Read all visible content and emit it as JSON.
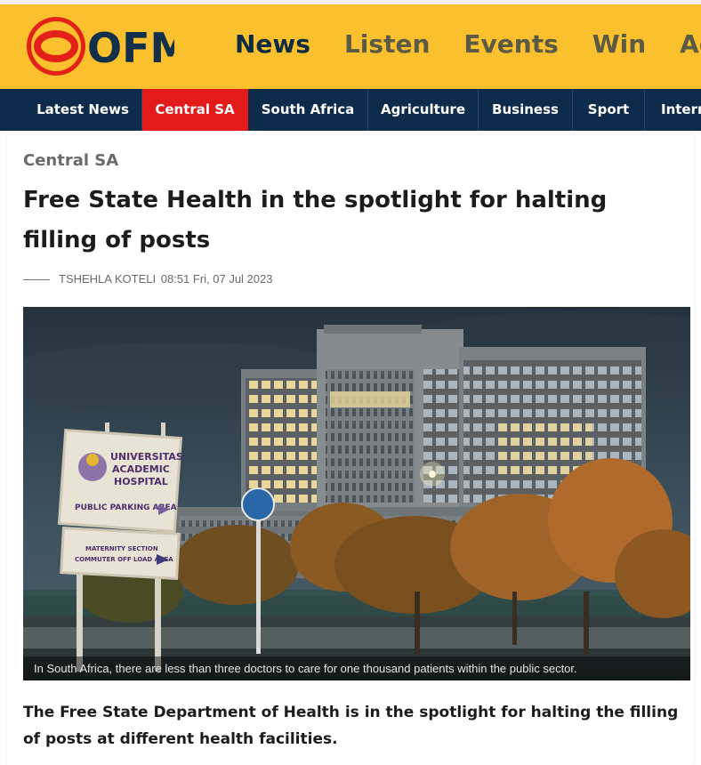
{
  "header": {
    "logo": {
      "text": "OFM",
      "icon": "ofm-logo-icon",
      "colors": {
        "ring": "#e32119",
        "text": "#12304a"
      }
    },
    "nav": [
      "News",
      "Listen",
      "Events",
      "Win",
      "Adv"
    ],
    "active_nav": "News"
  },
  "subnav": {
    "items": [
      "Latest News",
      "Central SA",
      "South Africa",
      "Agriculture",
      "Business",
      "Sport",
      "Intern"
    ],
    "active": "Central SA"
  },
  "article": {
    "category": "Central SA",
    "title": "Free State Health in the spotlight for halting filling of posts",
    "author": "TSHEHLA KOTELI",
    "datetime": "08:51 Fri, 07 Jul 2023",
    "image": {
      "signs": {
        "hospital_name": [
          "UNIVERSITAS",
          "ACADEMIC",
          "HOSPITAL"
        ],
        "parking": "PUBLIC PARKING AREA",
        "maternity": [
          "MATERNITY SECTION",
          "COMMUTER OFF LOAD AREA"
        ]
      },
      "caption": "In South Africa, there are less than three doctors to care for one thousand patients within the public sector."
    },
    "lede": "The Free State Department of Health is in the spotlight for halting the filling of posts at different health facilities."
  },
  "colors": {
    "topbar": "#fbc02d",
    "subnav": "#0d2c4b",
    "active_tab": "#e21a1a"
  }
}
